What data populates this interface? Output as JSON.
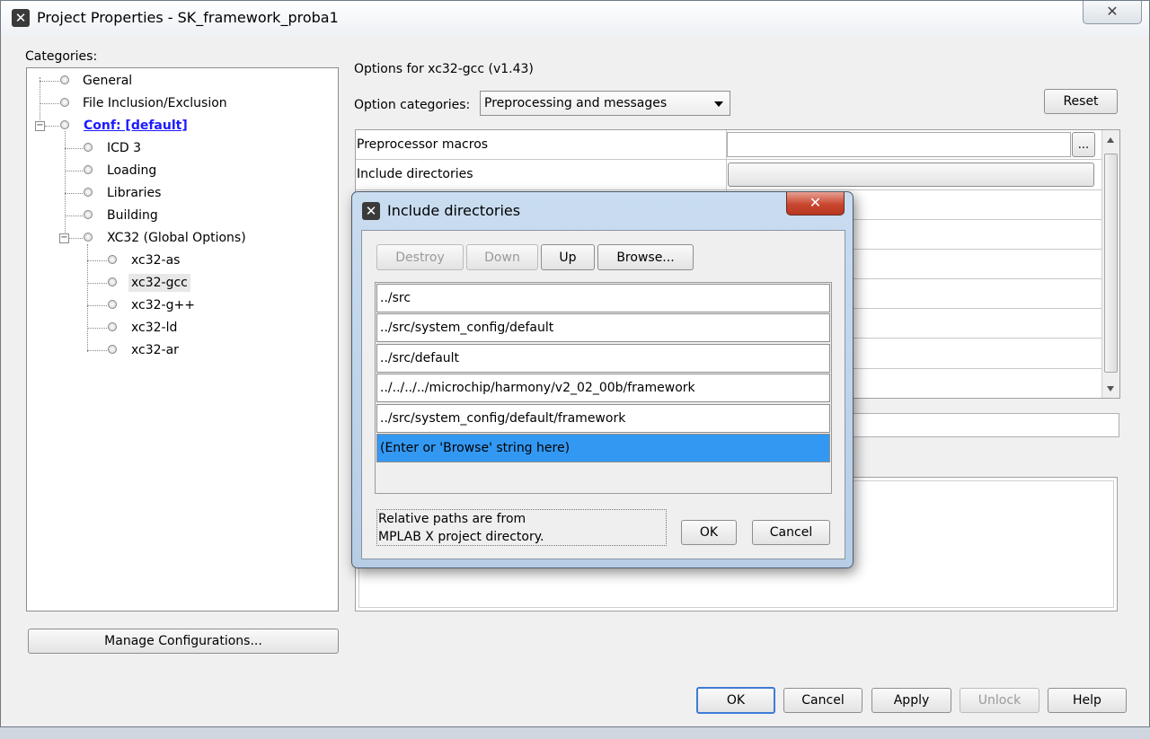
{
  "window": {
    "title": "Project Properties - SK_framework_proba1",
    "close_glyph": "✕"
  },
  "categories": {
    "label": "Categories:",
    "items": [
      {
        "label": "General"
      },
      {
        "label": "File Inclusion/Exclusion"
      },
      {
        "label": "Conf: [default]"
      },
      {
        "label": "ICD 3"
      },
      {
        "label": "Loading"
      },
      {
        "label": "Libraries"
      },
      {
        "label": "Building"
      },
      {
        "label": "XC32 (Global Options)"
      },
      {
        "label": "xc32-as"
      },
      {
        "label": "xc32-gcc"
      },
      {
        "label": "xc32-g++"
      },
      {
        "label": "xc32-ld"
      },
      {
        "label": "xc32-ar"
      }
    ],
    "selected": "xc32-gcc",
    "manage_button": "Manage Configurations..."
  },
  "options": {
    "header": "Options for xc32-gcc (v1.43)",
    "category_label": "Option categories:",
    "category_value": "Preprocessing and messages",
    "reset_button": "Reset",
    "rows": [
      {
        "name": "Preprocessor macros",
        "value": ""
      },
      {
        "name": "Include directories",
        "value": ""
      }
    ],
    "ellipsis_button": "..."
  },
  "dialog": {
    "title": "Include directories",
    "close_glyph": "✕",
    "buttons": {
      "destroy": "Destroy",
      "down": "Down",
      "up": "Up",
      "browse": "Browse..."
    },
    "entries": [
      "../src",
      "../src/system_config/default",
      "../src/default",
      "../../../../microchip/harmony/v2_02_00b/framework",
      "../src/system_config/default/framework"
    ],
    "placeholder_entry": "(Enter or 'Browse' string here)",
    "note_line1": "Relative paths are from",
    "note_line2": "MPLAB X project directory.",
    "ok": "OK",
    "cancel": "Cancel"
  },
  "footer": {
    "ok": "OK",
    "cancel": "Cancel",
    "apply": "Apply",
    "unlock": "Unlock",
    "help": "Help"
  },
  "colors": {
    "selection_blue": "#3398f2",
    "link_blue": "#1a1aff",
    "dialog_close_red": "#c9462f"
  }
}
